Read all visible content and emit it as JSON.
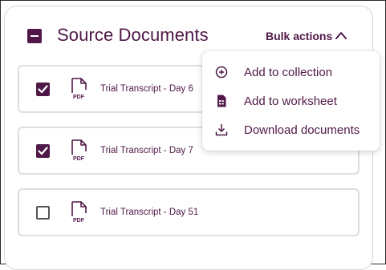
{
  "panel": {
    "title": "Source Documents",
    "bulk_actions_label": "Bulk actions",
    "bulk_actions_open": true,
    "select_all_state": "indeterminate"
  },
  "documents": [
    {
      "title": "Trial Transcript - Day 6",
      "checked": true,
      "file_type_icon": "pdf-file-icon",
      "file_type_label": "PDF"
    },
    {
      "title": "Trial Transcript - Day 7",
      "checked": true,
      "file_type_icon": "pdf-file-icon",
      "file_type_label": "PDF"
    },
    {
      "title": "Trial Transcript - Day 51",
      "checked": false,
      "file_type_icon": "pdf-file-icon",
      "file_type_label": "PDF"
    }
  ],
  "bulk_menu": {
    "items": [
      {
        "label": "Add to collection",
        "icon": "add-circle-icon"
      },
      {
        "label": "Add to worksheet",
        "icon": "worksheet-icon"
      },
      {
        "label": "Download documents",
        "icon": "download-icon"
      }
    ]
  },
  "colors": {
    "accent": "#4f1847",
    "row_border": "#dedee3",
    "panel_border": "#d9d9de"
  }
}
